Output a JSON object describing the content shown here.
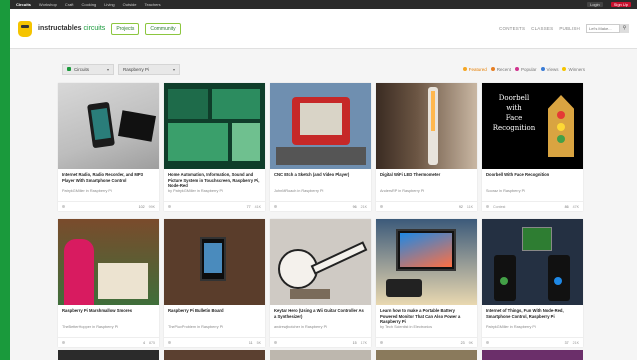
{
  "topbar": {
    "items": [
      "Circuits",
      "Workshop",
      "Craft",
      "Cooking",
      "Living",
      "Outside",
      "Teachers"
    ],
    "login": "Login",
    "signup": "Sign Up"
  },
  "header": {
    "brand_main": "instructables",
    "brand_accent": "circuits",
    "projects_btn": "Projects",
    "community_btn": "Community",
    "links": [
      "CONTESTS",
      "CLASSES",
      "PUBLISH"
    ],
    "search_placeholder": "Let's Make..."
  },
  "filters": {
    "category": "Circuits",
    "subcategory": "Raspberry Pi",
    "sorts": [
      {
        "label": "Featured",
        "color": "#f5a623",
        "active": true
      },
      {
        "label": "Recent",
        "color": "#e67e22",
        "active": false
      },
      {
        "label": "Popular",
        "color": "#d0348e",
        "active": false
      },
      {
        "label": "Views",
        "color": "#3a7bd5",
        "active": false
      },
      {
        "label": "Winners",
        "color": "#f5c400",
        "active": false
      }
    ]
  },
  "cards": [
    {
      "title": "Internet Radio, Radio Recorder, and MP3 Player With Smartphone Control",
      "author": "PatrykGMiller in Raspberry Pi",
      "favs": "102",
      "views": "99K"
    },
    {
      "title": "Home Automation, Information, Sound and Picture System in Touchscreen, Raspberry Pi, Node-Red",
      "author": "by PatrykGMiller in Raspberry Pi",
      "favs": "77",
      "views": "41K"
    },
    {
      "title": "CNC Etch a Sketch (and Video Player)",
      "author": "JohnMRoach in Raspberry Pi",
      "favs": "96",
      "views": "21K"
    },
    {
      "title": "Digital WiFi LED Thermometer",
      "author": "AndersRP in Raspberry Pi",
      "favs": "92",
      "views": "11K"
    },
    {
      "title": "Doorbell With Face Recognition",
      "author": "Sooraz in Raspberry Pi",
      "favs": "86",
      "views": "47K",
      "badge": "Contest"
    },
    {
      "title": "Raspberry Pi Marshmallow Smores",
      "author": "TheBetterHopper in Raspberry Pi",
      "favs": "4",
      "views": "875"
    },
    {
      "title": "Raspberry Pi Bulletin Board",
      "author": "ThePiuvProblem in Raspberry Pi",
      "favs": "11",
      "views": "5K"
    },
    {
      "title": "Keytar Hero (Using a Wii Guitar Controller As a Synthesizer)",
      "author": "andrewjbotcher in Raspberry Pi",
      "favs": "15",
      "views": "17K"
    },
    {
      "title": "Learn how to make a Portable Battery Powered Monitor That Can Also Power a Raspberry Pi",
      "author": "by Tech Scientist in Electronics",
      "favs": "23",
      "views": "9K"
    },
    {
      "title": "Internet of Things, Fun With Node-Red, Smartphone Control, Raspberry Pi",
      "author": "PatrykGMiller in Raspberry Pi",
      "favs": "37",
      "views": "21K"
    }
  ],
  "thumb_text": {
    "doorbell": [
      "Doorbell",
      "with",
      "Face",
      "Recognition"
    ]
  },
  "colors": {
    "page_green": "#1a9a3c",
    "accent_orange": "#e67e00",
    "community_green": "#8cc63f"
  }
}
